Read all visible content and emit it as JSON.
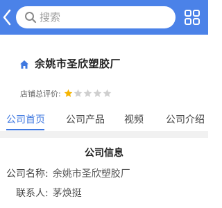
{
  "header": {
    "search_placeholder": "搜索",
    "colors": {
      "bar": "#4b82e8",
      "accent": "#3f78e0"
    }
  },
  "company": {
    "name": "余姚市圣欣塑胶厂",
    "rating_label": "店铺总评价:",
    "rating_filled": 1,
    "rating_total": 5
  },
  "tabs": [
    {
      "label": "公司首页",
      "active": true
    },
    {
      "label": "公司产品",
      "active": false
    },
    {
      "label": "视频",
      "active": false
    },
    {
      "label": "公司介绍",
      "active": false
    }
  ],
  "info": {
    "title": "公司信息",
    "rows": [
      {
        "label": "公司名称:",
        "value": "余姚市圣欣塑胶厂"
      },
      {
        "label": "联系人:",
        "value": "茅焕挺"
      }
    ]
  }
}
